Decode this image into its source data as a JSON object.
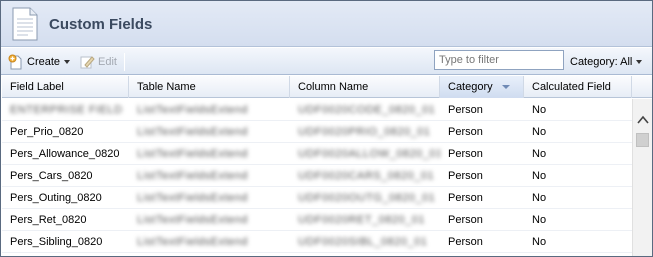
{
  "header": {
    "title": "Custom Fields",
    "icon": "document-icon"
  },
  "toolbar": {
    "create_label": "Create",
    "edit_label": "Edit",
    "filter_placeholder": "Type to filter",
    "category_label": "Category: All"
  },
  "grid": {
    "columns": [
      {
        "label": "Field Label"
      },
      {
        "label": "Table Name"
      },
      {
        "label": "Column Name"
      },
      {
        "label": "Category",
        "sorted": "descending"
      },
      {
        "label": "Calculated Field"
      }
    ],
    "rows": [
      {
        "field_label": "ENTERPRISE FIELD",
        "table_name": "ListTextFieldsExtend",
        "column_name": "UDF0020CODE_0820_01",
        "category": "Person",
        "calculated": "No"
      },
      {
        "field_label": "Per_Prio_0820",
        "table_name": "ListTextFieldsExtend",
        "column_name": "UDF0020PRIO_0820_01",
        "category": "Person",
        "calculated": "No"
      },
      {
        "field_label": "Pers_Allowance_0820",
        "table_name": "ListTextFieldsExtend",
        "column_name": "UDF0020ALLOW_0820_01",
        "category": "Person",
        "calculated": "No"
      },
      {
        "field_label": "Pers_Cars_0820",
        "table_name": "ListTextFieldsExtend",
        "column_name": "UDF0020CARS_0820_01",
        "category": "Person",
        "calculated": "No"
      },
      {
        "field_label": "Pers_Outing_0820",
        "table_name": "ListTextFieldsExtend",
        "column_name": "UDF0020OUTG_0820_01",
        "category": "Person",
        "calculated": "No"
      },
      {
        "field_label": "Pers_Ret_0820",
        "table_name": "ListTextFieldsExtend",
        "column_name": "UDF0020RET_0820_01",
        "category": "Person",
        "calculated": "No"
      },
      {
        "field_label": "Pers_Sibling_0820",
        "table_name": "ListTextFieldsExtend",
        "column_name": "UDF0020SIBL_0820_01",
        "category": "Person",
        "calculated": "No"
      }
    ]
  },
  "colors": {
    "header_bg": "#d4deef",
    "title_text": "#3b4a60",
    "border": "#5a6a80"
  }
}
